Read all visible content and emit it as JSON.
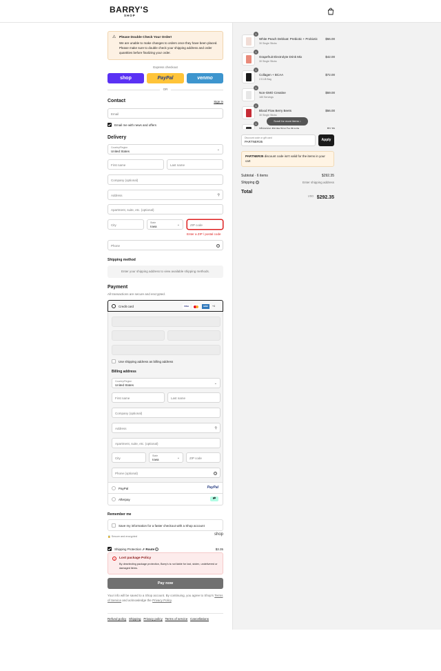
{
  "header": {
    "logo_main": "BARRY'S",
    "logo_sub": "SHOP"
  },
  "notice": {
    "title": "Please Double Check Your Order!",
    "body": "We are unable to make changes to orders once they have been placed. Please make sure to double check your shipping address and order quantities before finalizing your order."
  },
  "express": {
    "label": "Express checkout",
    "shop": "shop",
    "paypal": "PayPal",
    "venmo": "venmo",
    "or": "OR"
  },
  "contact": {
    "heading": "Contact",
    "sign_in": "Sign in",
    "email_placeholder": "Email",
    "news_label": "Email me with news and offers",
    "news_checked": true
  },
  "delivery": {
    "heading": "Delivery",
    "country_label": "Country/Region",
    "country_value": "United States",
    "first_name": "First name",
    "last_name": "Last name",
    "company": "Company (optional)",
    "address": "Address",
    "apartment": "Apartment, suite, etc. (optional)",
    "city": "City",
    "state_label": "State",
    "state_value": "Iowa",
    "zip": "ZIP code",
    "zip_error": "Enter a ZIP / postal code",
    "phone": "Phone"
  },
  "shipping_method": {
    "heading": "Shipping method",
    "message": "Enter your shipping address to view available shipping methods."
  },
  "payment": {
    "heading": "Payment",
    "subtitle": "All transactions are secure and encrypted.",
    "credit_card": "Credit card",
    "card_brands": [
      "VISA",
      "MC",
      "AMEX",
      "+4"
    ],
    "billing_same": "Use shipping address as billing address",
    "billing_heading": "Billing address",
    "billing": {
      "country_label": "Country/Region",
      "country_value": "United States",
      "first_name": "First name",
      "last_name": "Last name",
      "company": "Company (optional)",
      "address": "Address",
      "apartment": "Apartment, suite, etc. (optional)",
      "city": "City",
      "state_label": "State",
      "state_value": "Iowa",
      "zip": "ZIP code",
      "phone": "Phone (optional)"
    },
    "paypal": "PayPal",
    "paypal_logo": "PayPal",
    "afterpay": "Afterpay"
  },
  "remember": {
    "heading": "Remember me",
    "save_label": "Save my information for a faster checkout with a Shop account",
    "secure": "Secure and encrypted",
    "shop_logo": "shop"
  },
  "protection": {
    "label": "Shipping Protection",
    "by": "Route",
    "price": "$3.35",
    "checked": true,
    "lost_title": "Lost package Policy",
    "lost_body": "By deselecting package protection, Barry's is not liable for lost, stolen, undelivered or damaged items."
  },
  "pay_button": "Pay now",
  "legal": {
    "line1": "Your info will be saved to a Shop account. By continuing, you agree to Shop's",
    "tos": "Terms of Service",
    "and": "and acknowledge the",
    "privacy": "Privacy Policy",
    "end": "."
  },
  "footer_links": [
    "Refund policy",
    "Shipping",
    "Privacy policy",
    "Terms of service",
    "Cancellations"
  ],
  "cart": {
    "items": [
      {
        "name": "White Peach Debloat: Prebiotic + Probiotic",
        "variant": "30 Single Sticks",
        "price": "$56.00",
        "qty": "1",
        "color": "#f1ddd6"
      },
      {
        "name": "Grapefruit Electrolyte Drink Mix",
        "variant": "30 Single Sticks",
        "price": "$42.00",
        "qty": "1",
        "color": "#e98a7a"
      },
      {
        "name": "Collagen + BCAA",
        "variant": "2.5 LB Bag",
        "price": "$72.00",
        "qty": "1",
        "color": "#1a1a1a"
      },
      {
        "name": "Non-GMO Creatine",
        "variant": "180 Servings",
        "price": "$59.00",
        "qty": "1",
        "color": "#e7e7e7"
      },
      {
        "name": "Blood Flow Berry Beets",
        "variant": "30 Single Sticks",
        "price": "$56.00",
        "qty": "1",
        "color": "#c62b35"
      },
      {
        "name": "Shipping Protection by Route",
        "variant": "",
        "price": "$3.35",
        "qty": "1",
        "color": "#333333"
      }
    ],
    "scroll_hint": "Scroll for more items",
    "discount_label": "Discount code or gift card",
    "discount_value": "PARTNER35",
    "apply": "Apply",
    "discount_code": "PARTNER35",
    "discount_msg": "discount code isn't valid for the items in your cart",
    "subtotal_label": "Subtotal · 6 items",
    "subtotal_value": "$292.35",
    "shipping_label": "Shipping",
    "shipping_value": "Enter shipping address",
    "total_label": "Total",
    "currency": "USD",
    "total_value": "$292.35"
  }
}
